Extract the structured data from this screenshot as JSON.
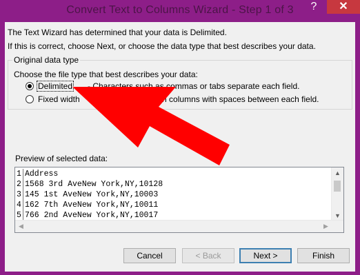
{
  "window": {
    "title": "Convert Text to Columns Wizard - Step 1 of 3",
    "help_icon": "?",
    "close_icon": "✕"
  },
  "intro": {
    "line1": "The Text Wizard has determined that your data is Delimited.",
    "line2": "If this is correct, choose Next, or choose the data type that best describes your data."
  },
  "original_data_type": {
    "legend": "Original data type",
    "prompt": "Choose the file type that best describes your data:",
    "options": [
      {
        "label": "Delimited",
        "description": "- Characters such as commas or tabs separate each field.",
        "selected": true
      },
      {
        "label": "Fixed width",
        "description": "- Fields are aligned in columns with spaces between each field.",
        "selected": false
      }
    ]
  },
  "preview": {
    "label": "Preview of selected data:",
    "rows": [
      {
        "num": "1",
        "text": "Address"
      },
      {
        "num": "2",
        "text": "1568 3rd AveNew York,NY,10128"
      },
      {
        "num": "3",
        "text": "145 1st AveNew York,NY,10003"
      },
      {
        "num": "4",
        "text": "162 7th AveNew York,NY,10011"
      },
      {
        "num": "5",
        "text": "766 2nd AveNew York,NY,10017"
      }
    ]
  },
  "buttons": {
    "cancel": "Cancel",
    "back": "< Back",
    "next": "Next >",
    "finish": "Finish"
  },
  "colors": {
    "frame": "#8d1e88",
    "close": "#c7383f",
    "annotation_arrow": "#ff0000"
  }
}
